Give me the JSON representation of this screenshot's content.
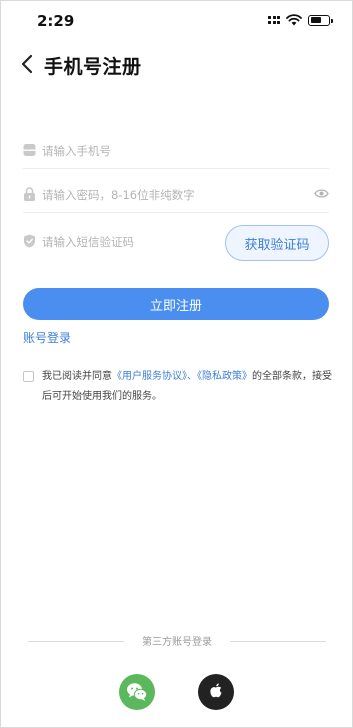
{
  "status_bar": {
    "time": "2:29"
  },
  "header": {
    "title": "手机号注册"
  },
  "form": {
    "phone": {
      "placeholder": "请输入手机号",
      "value": ""
    },
    "password": {
      "placeholder": "请输入密码，8-16位非纯数字",
      "value": ""
    },
    "code": {
      "placeholder": "请输入短信验证码",
      "value": ""
    },
    "get_code_label": "获取验证码",
    "register_label": "立即注册",
    "account_login_label": "账号登录"
  },
  "agreement": {
    "prefix": "我已阅读并同意",
    "user_agreement": "《用户服务协议》",
    "separator": "、",
    "privacy_policy": "《隐私政策》",
    "suffix": "的全部条款，接受后可开始使用我们的服务。",
    "checked": false
  },
  "third_party": {
    "label": "第三方账号登录",
    "providers": [
      "wechat-icon",
      "apple-icon"
    ]
  },
  "colors": {
    "accent": "#4a8ff0",
    "link": "#3d7fd9",
    "wechat": "#5cb85c",
    "apple": "#222222"
  }
}
